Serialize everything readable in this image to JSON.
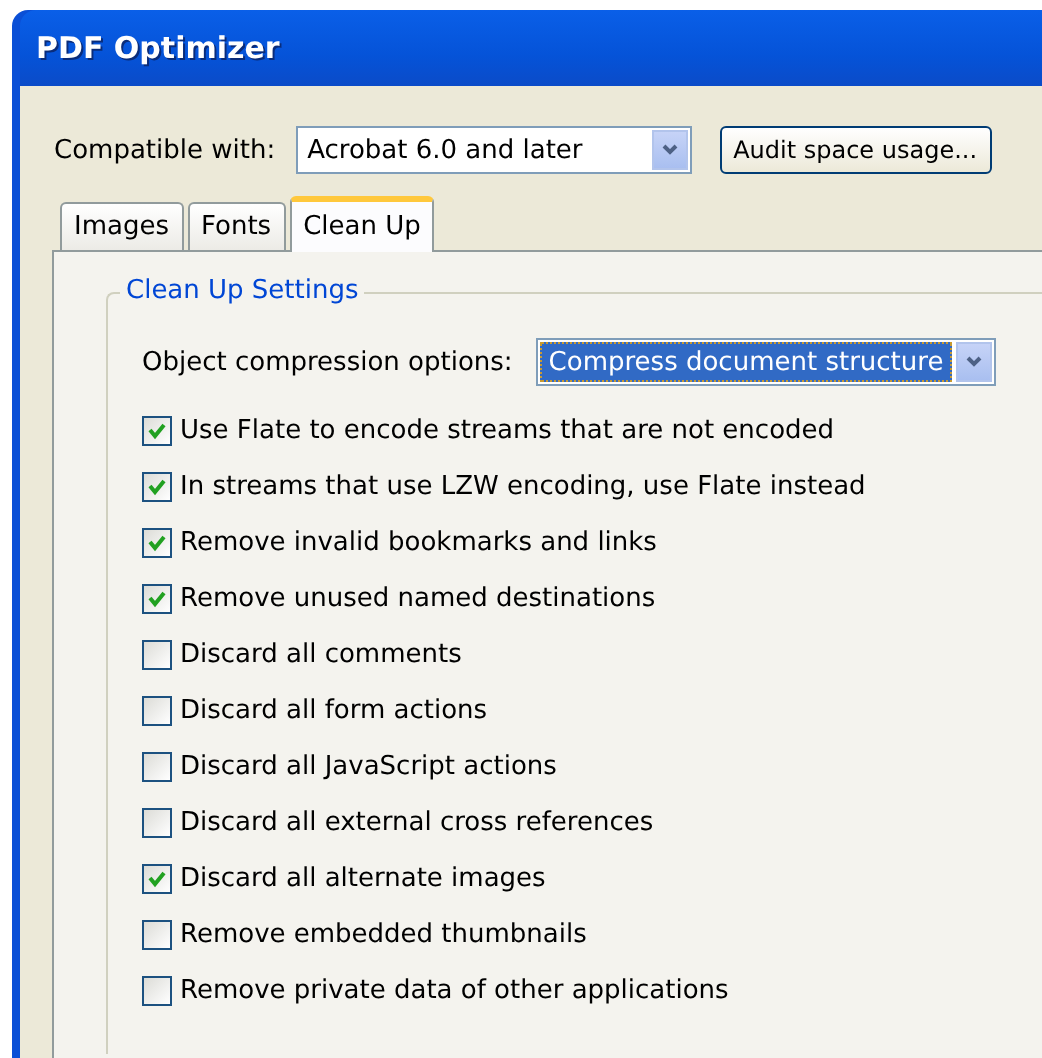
{
  "window": {
    "title": "PDF Optimizer"
  },
  "compatible": {
    "label": "Compatible with:",
    "value": "Acrobat 6.0 and later"
  },
  "audit_button": "Audit space usage...",
  "tabs": [
    {
      "label": "Images",
      "selected": false
    },
    {
      "label": "Fonts",
      "selected": false
    },
    {
      "label": "Clean Up",
      "selected": true
    }
  ],
  "group": {
    "title": "Clean Up Settings"
  },
  "compression": {
    "label": "Object compression options:",
    "value": "Compress document structure"
  },
  "options": [
    {
      "label": "Use Flate to encode streams that are not encoded",
      "checked": true
    },
    {
      "label": "In streams that use LZW encoding, use Flate instead",
      "checked": true
    },
    {
      "label": "Remove invalid bookmarks and links",
      "checked": true
    },
    {
      "label": "Remove unused named destinations",
      "checked": true
    },
    {
      "label": "Discard all comments",
      "checked": false
    },
    {
      "label": "Discard all form actions",
      "checked": false
    },
    {
      "label": "Discard all JavaScript actions",
      "checked": false
    },
    {
      "label": "Discard all external cross references",
      "checked": false
    },
    {
      "label": "Discard all alternate images",
      "checked": true
    },
    {
      "label": "Remove embedded thumbnails",
      "checked": false
    },
    {
      "label": "Remove private data of other applications",
      "checked": false
    }
  ]
}
